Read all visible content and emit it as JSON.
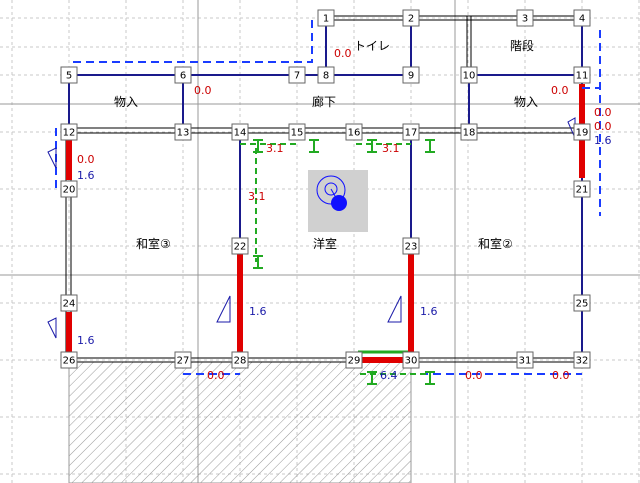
{
  "colors": {
    "wall_blue": "#1a1a8c",
    "wall_double": "#000000",
    "brace_red": "#e00000",
    "dash_blue": "#1a3cff",
    "dash_green": "#22aa22",
    "grid": "#c8c8c8",
    "label_red": "#cc0000",
    "label_blue": "#1a1aa8",
    "hatch": "#999999",
    "center_box": "#d0d0d0",
    "center_fill": "#1010ff"
  },
  "rooms": {
    "toilet": "トイレ",
    "stairs": "階段",
    "storage_left": "物入",
    "hallway": "廊下",
    "storage_right": "物入",
    "washitsu3": "和室③",
    "western": "洋室",
    "washitsu2": "和室②"
  },
  "nodes": [
    "1",
    "2",
    "3",
    "4",
    "5",
    "6",
    "7",
    "8",
    "9",
    "10",
    "11",
    "12",
    "13",
    "14",
    "15",
    "16",
    "17",
    "18",
    "19",
    "20",
    "21",
    "22",
    "23",
    "24",
    "25",
    "26",
    "27",
    "28",
    "29",
    "30",
    "31",
    "32"
  ],
  "values": {
    "v_toilet_red": "0.0",
    "v_6_red": "0.0",
    "v_11_red": "0.0",
    "v_19_red_a": "0.0",
    "v_19_red_b": "0.0",
    "v_19_blue": "1.6",
    "v_12_red": "0.0",
    "v_12_blue": "1.6",
    "v_14_green": "3.1",
    "v_16_green": "3.1",
    "v_22_green": "3.1",
    "v_22_blue": "1.6",
    "v_23_blue": "1.6",
    "v_24_blue": "1.6",
    "v_bottom_red_1": "0.0",
    "v_bottom_green": "6.4",
    "v_bottom_red_2": "0.0",
    "v_bottom_red_3": "0.0"
  }
}
